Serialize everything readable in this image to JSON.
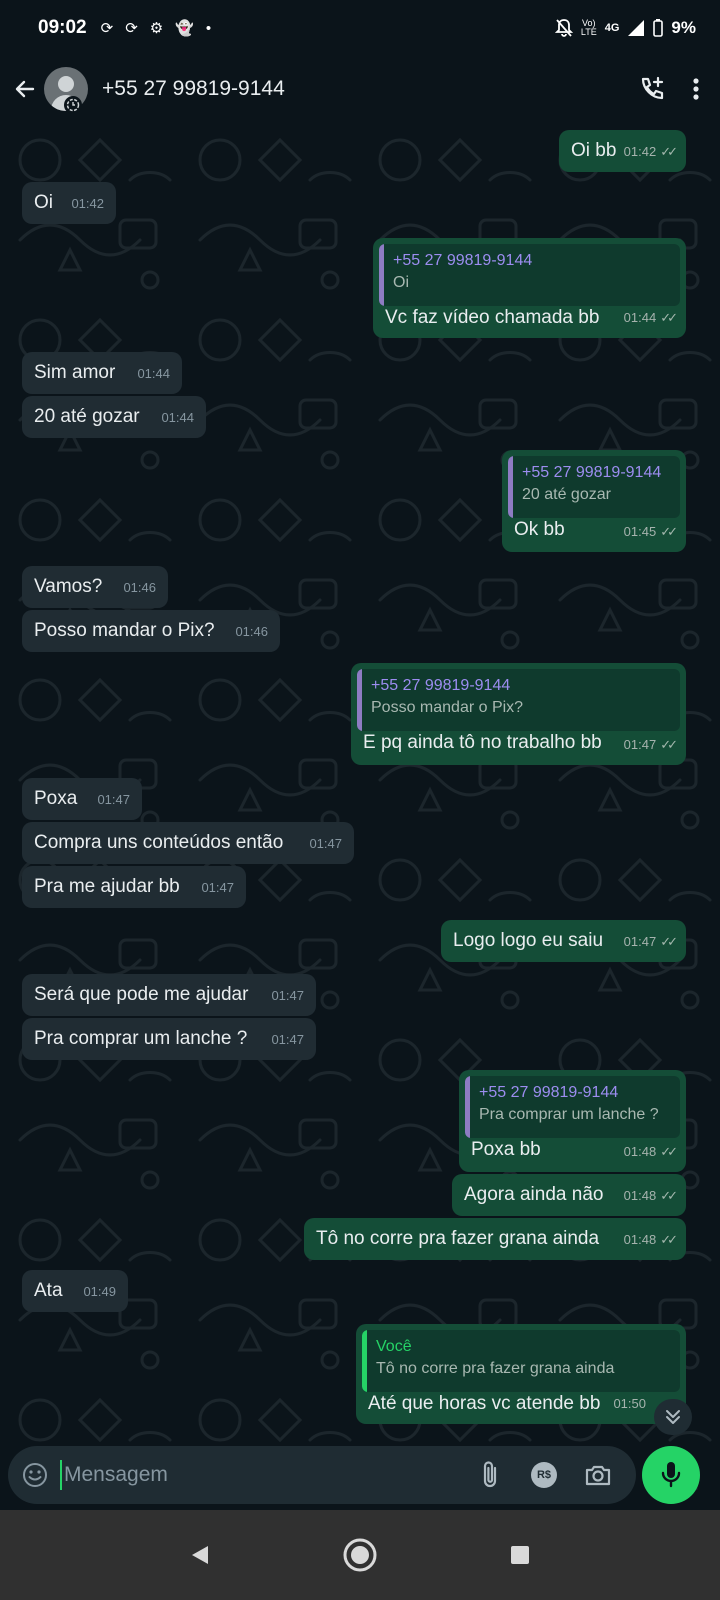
{
  "status": {
    "time": "09:02",
    "network_top": "Vo)",
    "network_mid": "LTE",
    "network_type": "4G",
    "battery": "9%"
  },
  "header": {
    "title": "+55 27 99819-9144",
    "icons": [
      "back-arrow-icon",
      "avatar",
      "add-call-icon",
      "more-vert-icon"
    ]
  },
  "messages": [
    {
      "id": "m1",
      "dir": "out",
      "text": "Oi bb",
      "time": "01:42"
    },
    {
      "id": "m2",
      "dir": "in",
      "text": "Oi",
      "time": "01:42"
    },
    {
      "id": "m3",
      "dir": "out",
      "text": "Vc faz vídeo chamada bb",
      "time": "01:44",
      "quote": {
        "name": "+55 27 99819-9144",
        "text": "Oi"
      }
    },
    {
      "id": "m4",
      "dir": "in",
      "text": "Sim amor",
      "time": "01:44"
    },
    {
      "id": "m5",
      "dir": "in",
      "text": "20 até gozar",
      "time": "01:44"
    },
    {
      "id": "m6",
      "dir": "out",
      "text": "Ok bb",
      "time": "01:45",
      "quote": {
        "name": "+55 27 99819-9144",
        "text": "20 até gozar"
      }
    },
    {
      "id": "m7",
      "dir": "in",
      "text": "Vamos?",
      "time": "01:46"
    },
    {
      "id": "m8",
      "dir": "in",
      "text": "Posso mandar o Pix?",
      "time": "01:46"
    },
    {
      "id": "m9",
      "dir": "out",
      "text": "E pq ainda tô no trabalho bb",
      "time": "01:47",
      "quote": {
        "name": "+55 27 99819-9144",
        "text": "Posso mandar o Pix?"
      }
    },
    {
      "id": "m10",
      "dir": "in",
      "text": "Poxa",
      "time": "01:47"
    },
    {
      "id": "m11",
      "dir": "in",
      "text": "Compra uns conteúdos então",
      "time": "01:47"
    },
    {
      "id": "m12",
      "dir": "in",
      "text": "Pra me ajudar bb",
      "time": "01:47"
    },
    {
      "id": "m13",
      "dir": "out",
      "text": "Logo logo eu saiu",
      "time": "01:47"
    },
    {
      "id": "m14",
      "dir": "in",
      "text": "Será que pode me ajudar",
      "time": "01:47"
    },
    {
      "id": "m15",
      "dir": "in",
      "text": "Pra comprar um lanche ?",
      "time": "01:47"
    },
    {
      "id": "m16",
      "dir": "out",
      "text": "Poxa bb",
      "time": "01:48",
      "quote": {
        "name": "+55 27 99819-9144",
        "text": "Pra comprar um lanche ?"
      }
    },
    {
      "id": "m17",
      "dir": "out",
      "text": "Agora ainda não",
      "time": "01:48"
    },
    {
      "id": "m18",
      "dir": "out",
      "text": "Tô no corre pra fazer grana ainda",
      "time": "01:48"
    },
    {
      "id": "m19",
      "dir": "in",
      "text": "Ata",
      "time": "01:49"
    },
    {
      "id": "m20",
      "dir": "out",
      "text": "Até que horas vc atende bb",
      "time": "01:50",
      "quote": {
        "name": "Você",
        "text": "Tô no corre pra fazer grana ainda",
        "you": true
      }
    }
  ],
  "composer": {
    "placeholder": "Mensagem",
    "payment_label": "R$"
  },
  "colors": {
    "background": "#0b141a",
    "incoming": "#202c33",
    "outgoing": "#144d37",
    "accent": "#25d366",
    "quote_name": "#9c8df0"
  }
}
